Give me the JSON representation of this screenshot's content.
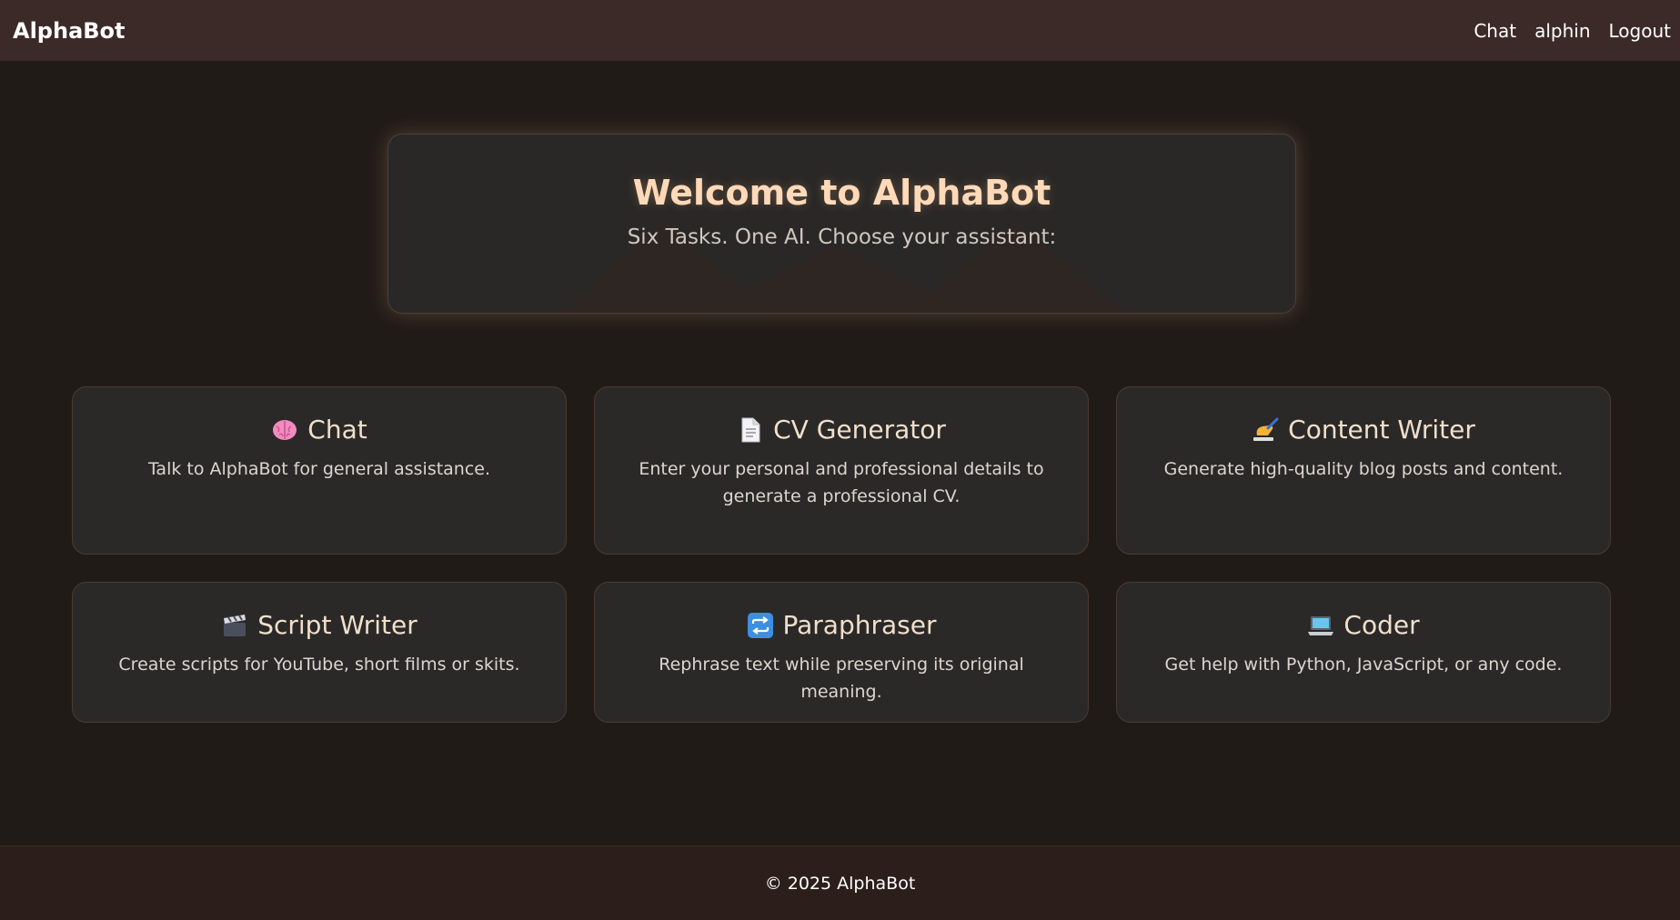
{
  "navbar": {
    "brand": "AlphaBot",
    "links": [
      "Chat",
      "alphin",
      "Logout"
    ]
  },
  "hero": {
    "title": "Welcome to AlphaBot",
    "subtitle": "Six Tasks. One AI. Choose your assistant:"
  },
  "cards": [
    {
      "icon": "brain-icon",
      "title": "Chat",
      "description": "Talk to AlphaBot for general assistance."
    },
    {
      "icon": "document-icon",
      "title": "CV Generator",
      "description": "Enter your personal and professional details to generate a professional CV."
    },
    {
      "icon": "writing-hand-icon",
      "title": "Content Writer",
      "description": "Generate high-quality blog posts and content."
    },
    {
      "icon": "clapper-board-icon",
      "title": "Script Writer",
      "description": "Create scripts for YouTube, short films or skits."
    },
    {
      "icon": "repeat-arrows-icon",
      "title": "Paraphraser",
      "description": "Rephrase text while preserving its original meaning."
    },
    {
      "icon": "laptop-icon",
      "title": "Coder",
      "description": "Get help with Python, JavaScript, or any code."
    }
  ],
  "footer": {
    "copyright": "© 2025 AlphaBot"
  },
  "colors": {
    "navbar_bg": "#3b2a27",
    "page_bg": "#211b18",
    "card_bg": "#2a2928",
    "hero_title": "#ffd9b8",
    "footer_bg": "#2c1f1b"
  }
}
